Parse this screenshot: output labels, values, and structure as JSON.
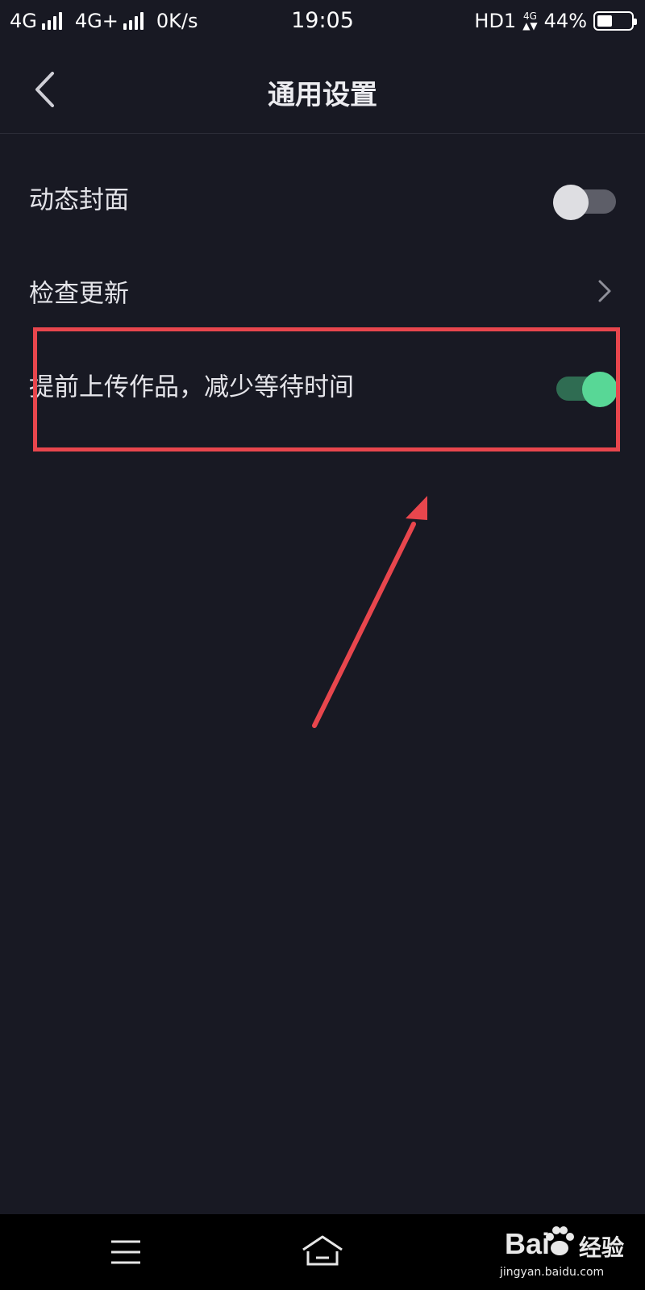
{
  "status_bar": {
    "network_1": "4G",
    "network_2": "4G+",
    "speed": "0K/s",
    "time": "19:05",
    "hd": "HD1",
    "small_net_top": "4G",
    "small_net_bottom": "▲▼",
    "battery_percent": "44%",
    "battery_level": 0.44
  },
  "header": {
    "back_icon": "chevron-left-icon",
    "title": "通用设置"
  },
  "settings": [
    {
      "label": "动态封面",
      "control": "toggle",
      "on": false
    },
    {
      "label": "检查更新",
      "control": "chevron"
    },
    {
      "label": "提前上传作品，减少等待时间",
      "control": "toggle",
      "on": true
    }
  ],
  "annotation": {
    "color": "#e8464d"
  },
  "nav_bar": {
    "menu_icon": "menu-icon",
    "home_icon": "home-icon"
  },
  "watermark": {
    "logo_text": "Bai",
    "logo_text_2": "经验",
    "url": "jingyan.baidu.com"
  },
  "colors": {
    "background": "#181923",
    "toggle_on": "#58d796",
    "toggle_off": "#dedee2"
  }
}
